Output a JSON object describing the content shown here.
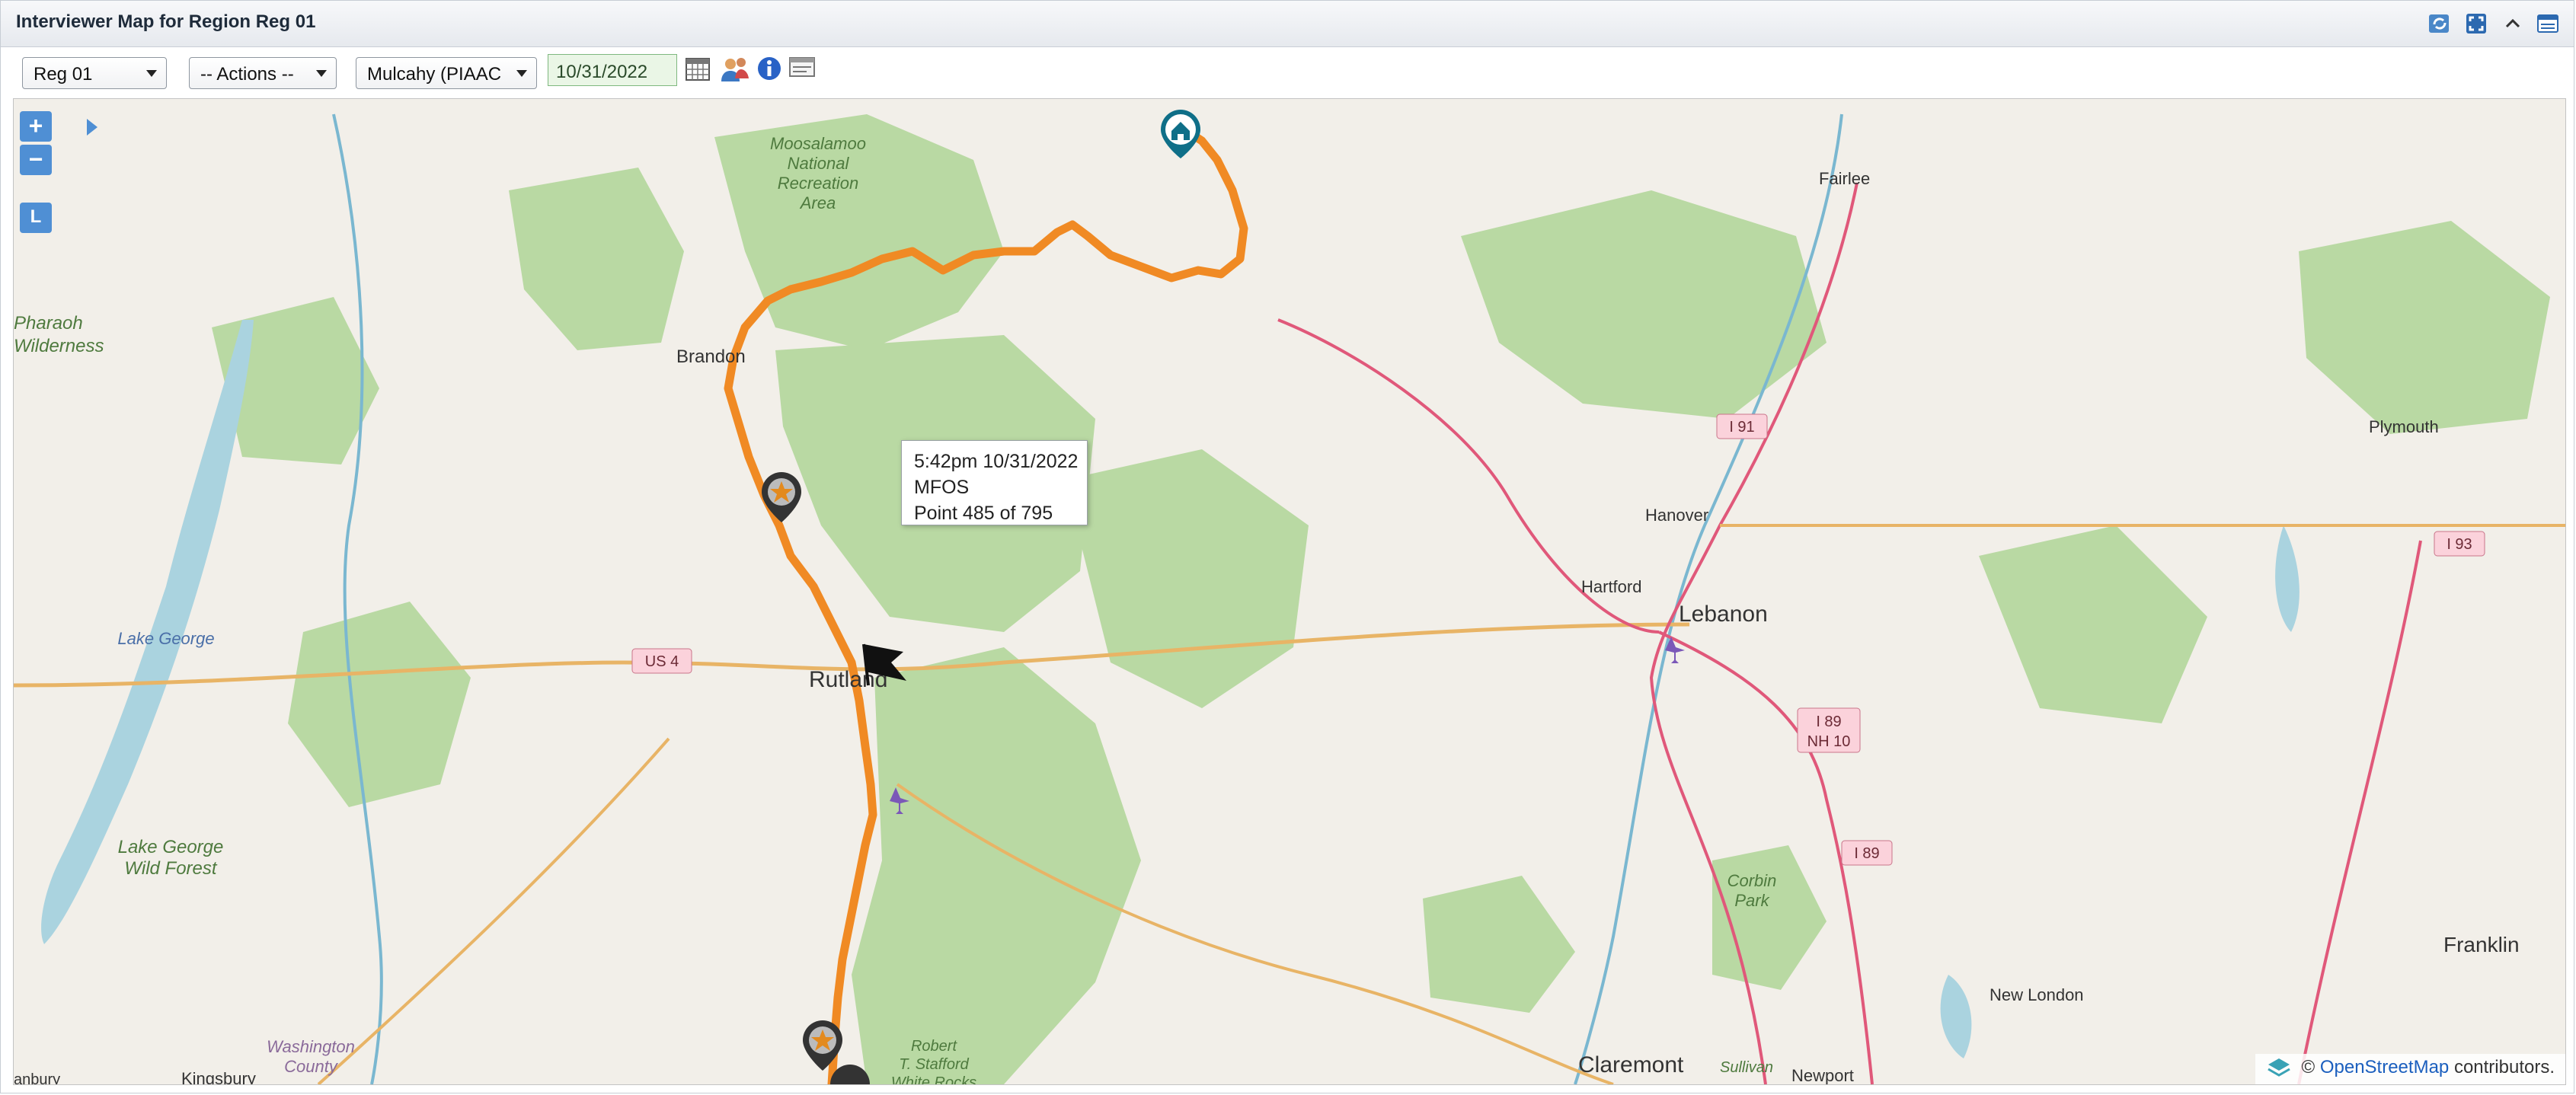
{
  "window": {
    "title": "Interviewer Map for Region Reg 01"
  },
  "toolbar": {
    "region_select": "Reg 01",
    "actions_select": "-- Actions --",
    "interviewer_select": "Mulcahy (PIAAC",
    "date_value": "10/31/2022"
  },
  "tooltip": {
    "line1": "5:42pm 10/31/2022",
    "line2": "MFOS",
    "line3": "Point 485 of 795"
  },
  "zoom": {
    "in": "+",
    "out": "−",
    "layers": "L"
  },
  "map": {
    "labels": {
      "moosalamoo": [
        "Moosalamoo",
        "National",
        "Recreation",
        "Area"
      ],
      "pharaoh": [
        "Pharaoh",
        "Wilderness"
      ],
      "brandon": "Brandon",
      "rutland": "Rutland",
      "lake_george": "Lake George",
      "lake_george_forest": [
        "Lake George",
        "Wild Forest"
      ],
      "washington_county": [
        "Washington",
        "County"
      ],
      "kingsbury": "Kingsbury",
      "robert_stafford": [
        "Robert",
        "T. Stafford",
        "White Rocks"
      ],
      "fairlee": "Fairlee",
      "hanover": "Hanover",
      "hartford": "Hartford",
      "lebanon": "Lebanon",
      "corbin_park": [
        "Corbin",
        "Park"
      ],
      "claremont": "Claremont",
      "sullivan": "Sullivan",
      "newport": "Newport",
      "new_london": "New London",
      "franklin": "Franklin",
      "plymouth": "Plymouth",
      "anbury": "anbury"
    },
    "shields": {
      "us4": "US 4",
      "i91": "I 91",
      "i93": "I 93",
      "i89a": "I 89",
      "nh10": "NH 10",
      "i89b": "I 89"
    }
  },
  "attribution": {
    "prefix": "©",
    "link": "OpenStreetMap",
    "suffix": "contributors."
  },
  "colors": {
    "route": "#f08a24",
    "forest": "#b7d9a4",
    "water": "#aad3df",
    "zoom": "#4f8fd4"
  },
  "icons": [
    "refresh-icon",
    "fullscreen-icon",
    "collapse-icon",
    "window-icon",
    "calendar-icon",
    "people-icon",
    "info-icon",
    "card-icon",
    "home-marker-icon",
    "star-marker-icon",
    "flag-icon",
    "airport-icon",
    "layer-icon"
  ]
}
